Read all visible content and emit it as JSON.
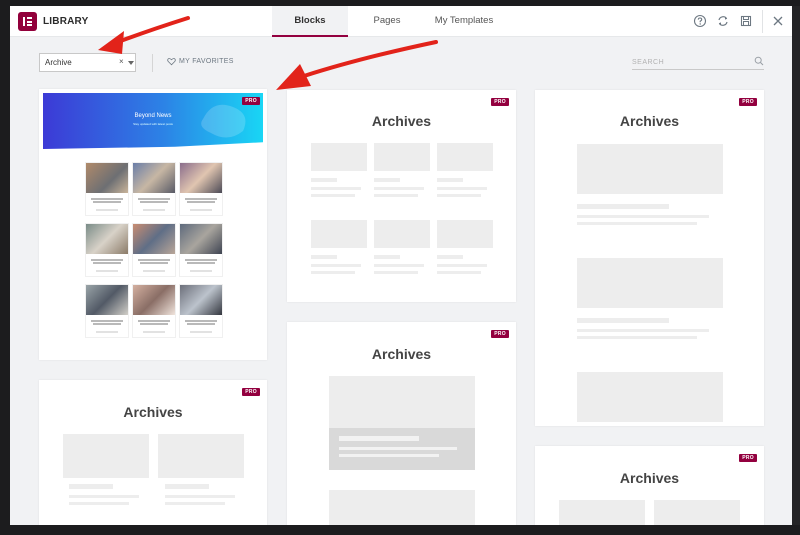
{
  "header": {
    "title": "LIBRARY",
    "tabs": [
      {
        "label": "Blocks",
        "active": true
      },
      {
        "label": "Pages",
        "active": false
      },
      {
        "label": "My Templates",
        "active": false
      }
    ],
    "icons": [
      "help-icon",
      "sync-icon",
      "save-icon",
      "close-icon"
    ]
  },
  "filter": {
    "category_value": "Archive",
    "clear_symbol": "×",
    "favorites_label": "MY FAVORITES",
    "search_placeholder": "SEARCH"
  },
  "cards": {
    "pro_badge": "PRO",
    "hero_title": "Beyond News",
    "hero_subtitle": "Stay updated with latest posts",
    "archive_title": "Archives"
  },
  "colors": {
    "brand": "#92003b",
    "annotation_arrow": "#e2231a"
  }
}
